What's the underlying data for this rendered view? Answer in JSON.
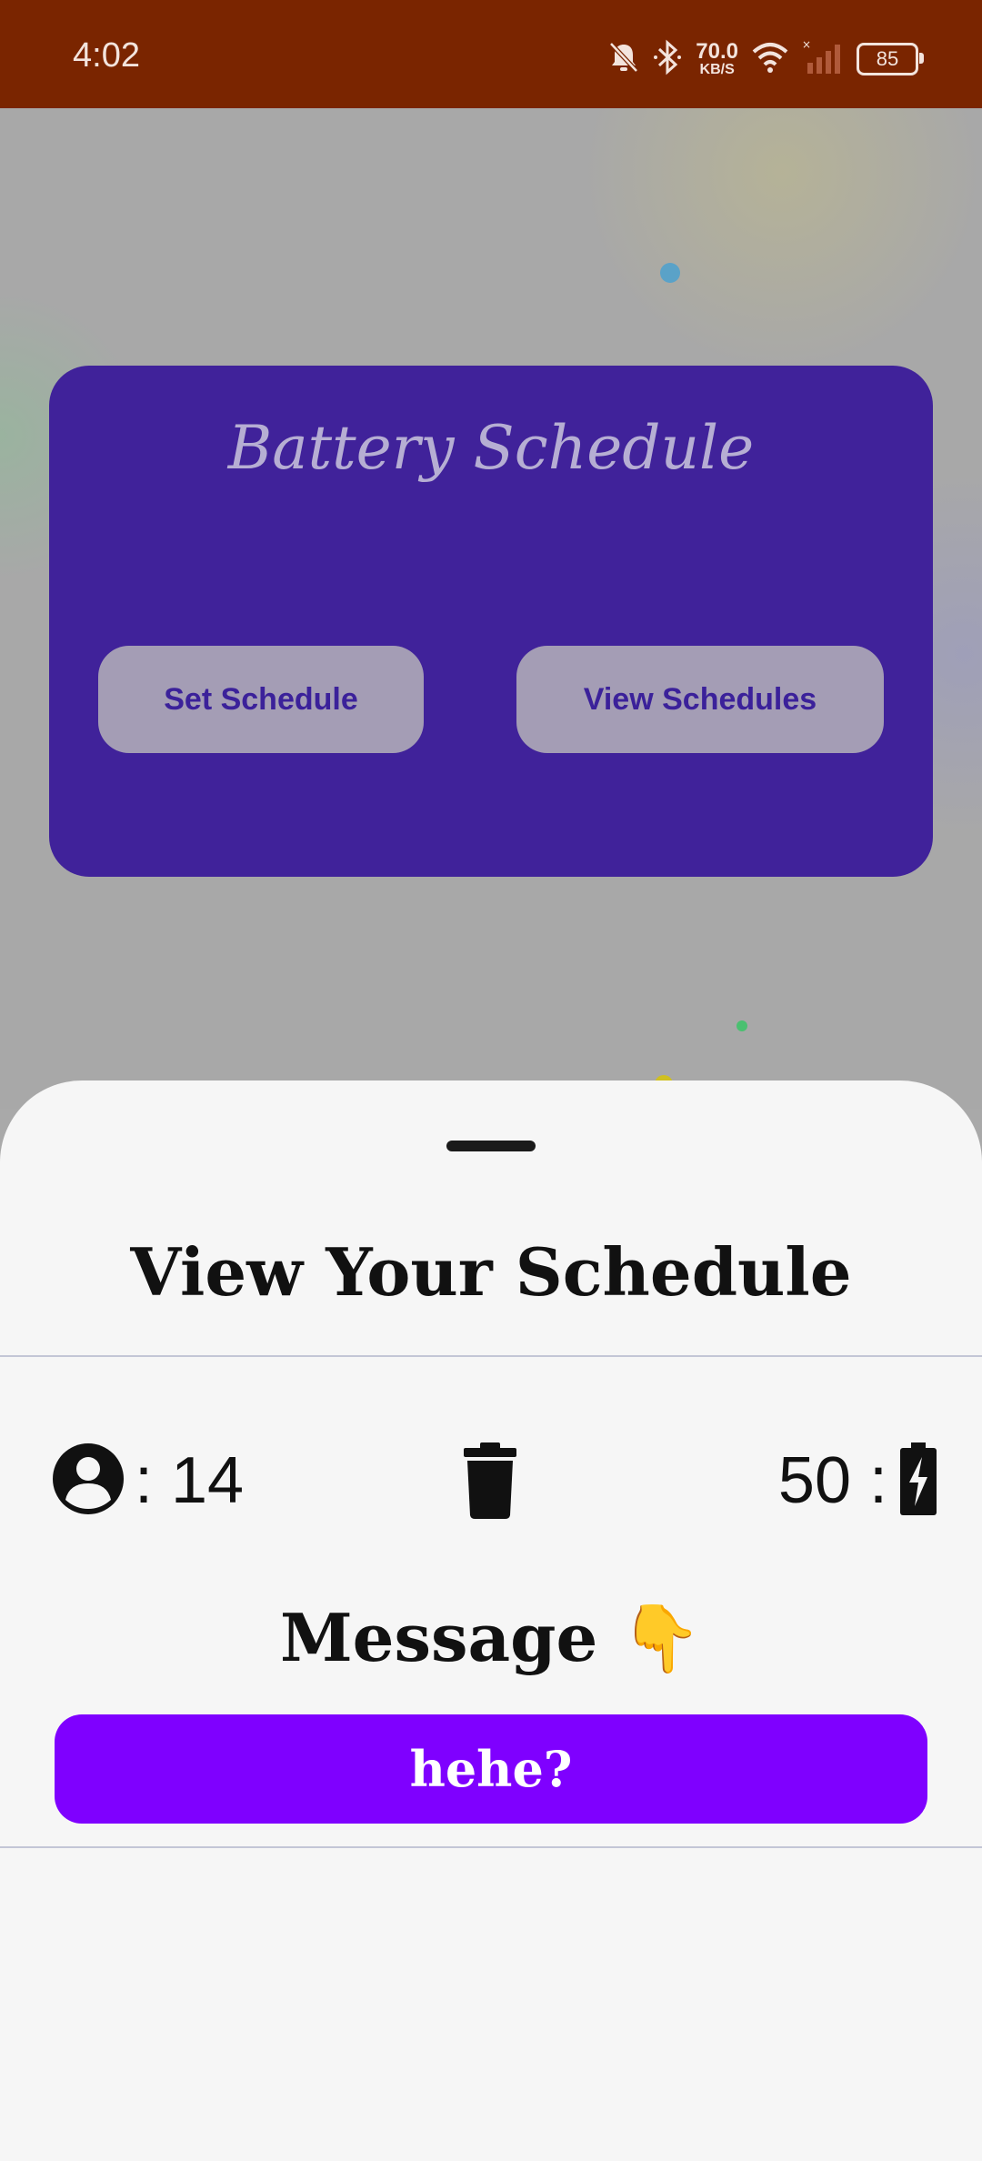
{
  "status_bar": {
    "time": "4:02",
    "net_speed_value": "70.0",
    "net_speed_unit": "KB/S",
    "battery_level": "85",
    "icons": [
      "bell-off-icon",
      "bluetooth-icon",
      "wifi-icon",
      "signal-icon",
      "battery-icon"
    ]
  },
  "app": {
    "card_title": "Battery Schedule",
    "set_schedule_label": "Set Schedule",
    "view_schedules_label": "View Schedules",
    "card_color": "#40229a"
  },
  "sheet": {
    "title": "View Your Schedule",
    "user_value": ": 14",
    "battery_value": "50 :",
    "message_label": "Message",
    "message_emoji": "👇",
    "message_button_label": "hehe?",
    "accent_color": "#7f00ff",
    "icons": [
      "user-circle-icon",
      "trash-icon",
      "battery-charging-icon"
    ]
  }
}
